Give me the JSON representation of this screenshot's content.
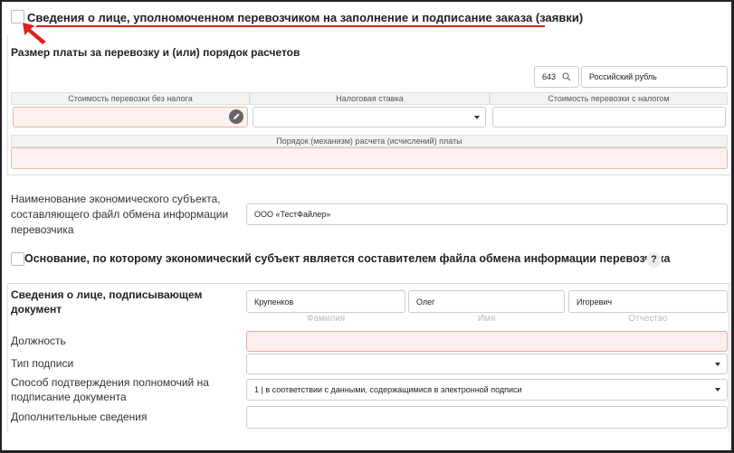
{
  "section1": {
    "checkbox_title": "Сведения о лице, уполномоченном перевозчиком на заполнение и подписание заказа (заявки)"
  },
  "payment": {
    "title": "Размер платы за перевозку и (или) порядок расчетов",
    "currency_code": "643",
    "currency_name": "Российский рубль",
    "col_without_tax": "Стоимость перевозки без налога",
    "col_tax_rate": "Налоговая ставка",
    "col_with_tax": "Стоимость перевозки с налогом",
    "procedure_header": "Порядок (механизм) расчета (исчислений) платы"
  },
  "entity": {
    "label": "Наименование экономического субъекта, составляющего файл обмена информации перевозчика",
    "label_line1": "Наименование экономического субъекта,",
    "label_line2": "составляющего файл обмена информации",
    "label_line3": "перевозчика",
    "value": "ООО «ТестФайлер»"
  },
  "basis": {
    "checkbox_title": "Основание, по которому экономический субъект является составителем файла обмена информации перевозчика",
    "help": "?"
  },
  "signer": {
    "title_line1": "Сведения о лице, подписывающем",
    "title_line2": "документ",
    "last_name": "Крупенков",
    "first_name": "Олег",
    "middle_name": "Игоревич",
    "last_name_hint": "Фамилия",
    "first_name_hint": "Имя",
    "middle_name_hint": "Отчество",
    "position_label": "Должность",
    "signature_type_label": "Тип подписи",
    "authority_label_line1": "Способ подтверждения полномочий на",
    "authority_label_line2": "подписание документа",
    "authority_value": "1 | в соответствии с данными, содержащимися в электронной подписи",
    "additional_label": "Дополнительные сведения"
  },
  "colors": {
    "annotation_red": "#e0201b",
    "required_bg": "#fdf1ef"
  }
}
